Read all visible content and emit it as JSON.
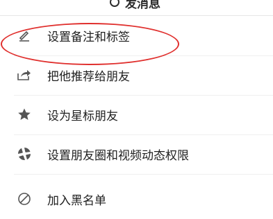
{
  "header": {
    "partial_label": "发消息"
  },
  "menu": {
    "items": [
      {
        "label": "设置备注和标签",
        "icon": "edit-icon"
      },
      {
        "label": "把他推荐给朋友",
        "icon": "share-icon"
      },
      {
        "label": "设为星标朋友",
        "icon": "star-icon"
      },
      {
        "label": "设置朋友圈和视频动态权限",
        "icon": "moments-icon"
      },
      {
        "label": "加入黑名单",
        "icon": "block-icon"
      }
    ]
  },
  "colors": {
    "annotation": "#e0302e",
    "icon": "#555555",
    "text": "#1f1f1f"
  }
}
